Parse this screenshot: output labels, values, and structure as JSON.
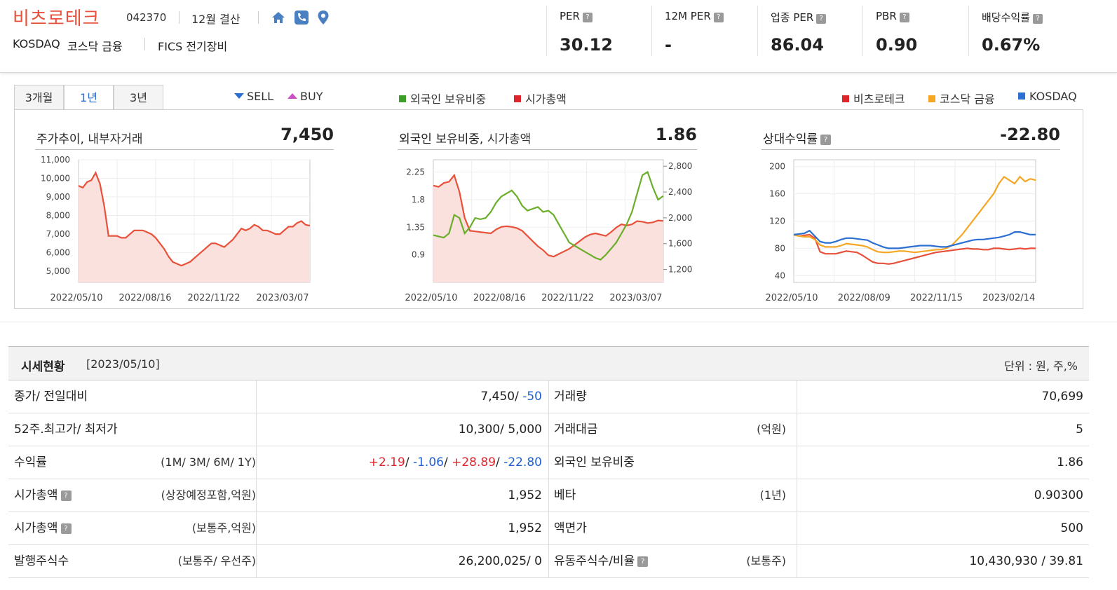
{
  "header": {
    "company": "비츠로테크",
    "code": "042370",
    "fiscal": "12월 결산",
    "market": "KOSDAQ",
    "sector": "코스닥 금융",
    "fics": "FICS 전기장비",
    "icons": [
      "home-icon",
      "phone-icon",
      "location-pin-icon"
    ],
    "metrics": [
      {
        "label": "PER",
        "value": "30.12"
      },
      {
        "label": "12M PER",
        "value": "-"
      },
      {
        "label": "업종 PER",
        "value": "86.04"
      },
      {
        "label": "PBR",
        "value": "0.90"
      },
      {
        "label": "배당수익률",
        "value": "0.67%"
      }
    ]
  },
  "tabs": [
    "3개월",
    "1년",
    "3년"
  ],
  "legend": {
    "sell": "SELL",
    "buy": "BUY",
    "foreign": "외국인 보유비중",
    "mcap": "시가총액",
    "stock": "비츠로테크",
    "sector": "코스닥 금융",
    "kosdaq": "KOSDAQ"
  },
  "colors": {
    "price_line": "#e8503a",
    "price_fill": "#fbe1dd",
    "foreign_line": "#6aae2a",
    "sector_line": "#f5a623",
    "kosdaq_line": "#2a6fd1",
    "red": "#e0242c",
    "blue": "#1f5fd1"
  },
  "charts": {
    "price": {
      "title": "주가추이,",
      "subtitle": "내부자거래",
      "value": "7,450"
    },
    "foreign": {
      "title": "외국인 보유비중,",
      "subtitle": "시가총액",
      "value": "1.86"
    },
    "relative": {
      "title": "상대수익률",
      "value": "-22.80"
    }
  },
  "chart_data": [
    {
      "type": "area",
      "title": "주가추이",
      "x_ticks": [
        "2022/05/10",
        "2022/08/16",
        "2022/11/22",
        "2023/03/07"
      ],
      "y_ticks": [
        "11,000",
        "10,000",
        "9,000",
        "8,000",
        "7,000",
        "6,000",
        "5,000"
      ],
      "ylim": [
        4400,
        11000
      ],
      "series": [
        {
          "name": "비츠로테크",
          "values": [
            9600,
            9500,
            9800,
            9900,
            10300,
            9700,
            8500,
            6900,
            6900,
            6900,
            6800,
            6800,
            7000,
            7200,
            7200,
            7200,
            7100,
            7000,
            6800,
            6500,
            6200,
            5800,
            5500,
            5400,
            5300,
            5400,
            5500,
            5700,
            5900,
            6100,
            6300,
            6500,
            6500,
            6400,
            6300,
            6500,
            6700,
            7000,
            7300,
            7200,
            7300,
            7500,
            7400,
            7200,
            7200,
            7100,
            7000,
            7000,
            7200,
            7400,
            7400,
            7600,
            7700,
            7500,
            7450
          ]
        }
      ]
    },
    {
      "type": "line",
      "title": "외국인 보유비중, 시가총액",
      "x_ticks": [
        "2022/05/10",
        "2022/08/16",
        "2022/11/22",
        "2023/03/07"
      ],
      "y_left_ticks": [
        "2.25",
        "1.8",
        "1.35",
        "0.9"
      ],
      "y_right_ticks": [
        "2,800",
        "2,400",
        "2,000",
        "1,600",
        "1,200"
      ],
      "ylim_left": [
        0.45,
        2.45
      ],
      "ylim_right": [
        1000,
        2900
      ],
      "series": [
        {
          "name": "외국인 보유비중",
          "axis": "left",
          "values": [
            1.22,
            1.2,
            1.18,
            1.25,
            1.55,
            1.5,
            1.25,
            1.35,
            1.5,
            1.48,
            1.5,
            1.6,
            1.75,
            1.85,
            1.9,
            1.95,
            1.85,
            1.7,
            1.62,
            1.65,
            1.68,
            1.6,
            1.62,
            1.55,
            1.4,
            1.25,
            1.1,
            1.05,
            1.0,
            0.95,
            0.9,
            0.85,
            0.82,
            0.9,
            1.0,
            1.1,
            1.25,
            1.4,
            1.6,
            1.9,
            2.2,
            2.25,
            2.0,
            1.8,
            1.86
          ]
        },
        {
          "name": "시가총액",
          "axis": "right",
          "values": [
            2500,
            2480,
            2540,
            2560,
            2660,
            2400,
            2000,
            1800,
            1790,
            1780,
            1770,
            1760,
            1820,
            1860,
            1870,
            1860,
            1840,
            1800,
            1720,
            1640,
            1560,
            1500,
            1420,
            1400,
            1440,
            1480,
            1520,
            1580,
            1640,
            1700,
            1740,
            1760,
            1740,
            1720,
            1780,
            1850,
            1900,
            1880,
            1900,
            1950,
            1940,
            1920,
            1930,
            1960,
            1952
          ]
        }
      ]
    },
    {
      "type": "line",
      "title": "상대수익률",
      "x_ticks": [
        "2022/05/10",
        "2022/08/09",
        "2022/11/15",
        "2023/02/14"
      ],
      "y_ticks": [
        "200",
        "160",
        "120",
        "80",
        "40"
      ],
      "ylim": [
        30,
        210
      ],
      "series": [
        {
          "name": "비츠로테크",
          "values": [
            100,
            98,
            99,
            100,
            95,
            75,
            72,
            72,
            72,
            74,
            76,
            75,
            74,
            70,
            65,
            60,
            58,
            58,
            57,
            58,
            60,
            62,
            64,
            66,
            68,
            70,
            72,
            74,
            75,
            76,
            77,
            78,
            79,
            80,
            79,
            79,
            78,
            78,
            80,
            80,
            79,
            78,
            79,
            80,
            79,
            80,
            80
          ]
        },
        {
          "name": "코스닥 금융",
          "values": [
            100,
            98,
            97,
            97,
            93,
            85,
            82,
            82,
            82,
            84,
            87,
            86,
            85,
            84,
            82,
            78,
            75,
            74,
            74,
            75,
            76,
            76,
            75,
            74,
            75,
            76,
            77,
            78,
            78,
            80,
            84,
            92,
            100,
            110,
            120,
            130,
            140,
            150,
            160,
            175,
            185,
            180,
            175,
            185,
            178,
            182,
            180
          ]
        },
        {
          "name": "KOSDAQ",
          "values": [
            100,
            101,
            102,
            106,
            98,
            90,
            88,
            88,
            90,
            93,
            95,
            95,
            94,
            93,
            92,
            88,
            85,
            82,
            80,
            80,
            80,
            81,
            82,
            83,
            84,
            84,
            84,
            83,
            82,
            82,
            84,
            86,
            88,
            90,
            92,
            93,
            93,
            94,
            95,
            96,
            98,
            100,
            104,
            104,
            102,
            100,
            100
          ]
        }
      ]
    }
  ],
  "table": {
    "title": "시세현황",
    "date": "[2023/05/10]",
    "unit": "단위 : 원, 주,%",
    "rows": [
      {
        "label": "종가/ 전일대비",
        "sub": "",
        "value_a": "7,450/",
        "value_b": "-50",
        "label2": "거래량",
        "sub2": "",
        "value2": "70,699"
      },
      {
        "label": "52주.최고가/ 최저가",
        "sub": "",
        "value": "10,300/ 5,000",
        "label2": "거래대금",
        "sub2": "(억원)",
        "value2": "5"
      },
      {
        "label": "수익률",
        "sub": "(1M/ 3M/ 6M/ 1Y)",
        "ret": [
          "+2.19",
          "/",
          "-1.06",
          "/",
          "+28.89",
          "/",
          "-22.80"
        ],
        "label2": "외국인 보유비중",
        "sub2": "",
        "value2": "1.86"
      },
      {
        "label": "시가총액",
        "sub": "(상장예정포함,억원)",
        "value": "1,952",
        "label2": "베타",
        "sub2": "(1년)",
        "value2": "0.90300"
      },
      {
        "label": "시가총액",
        "sub": "(보통주,억원)",
        "value": "1,952",
        "label2": "액면가",
        "sub2": "",
        "value2": "500"
      },
      {
        "label": "발행주식수",
        "sub": "(보통주/ 우선주)",
        "value": "26,200,025/ 0",
        "label2": "유동주식수/비율",
        "sub2": "(보통주)",
        "value2": "10,430,930 / 39.81"
      }
    ]
  }
}
